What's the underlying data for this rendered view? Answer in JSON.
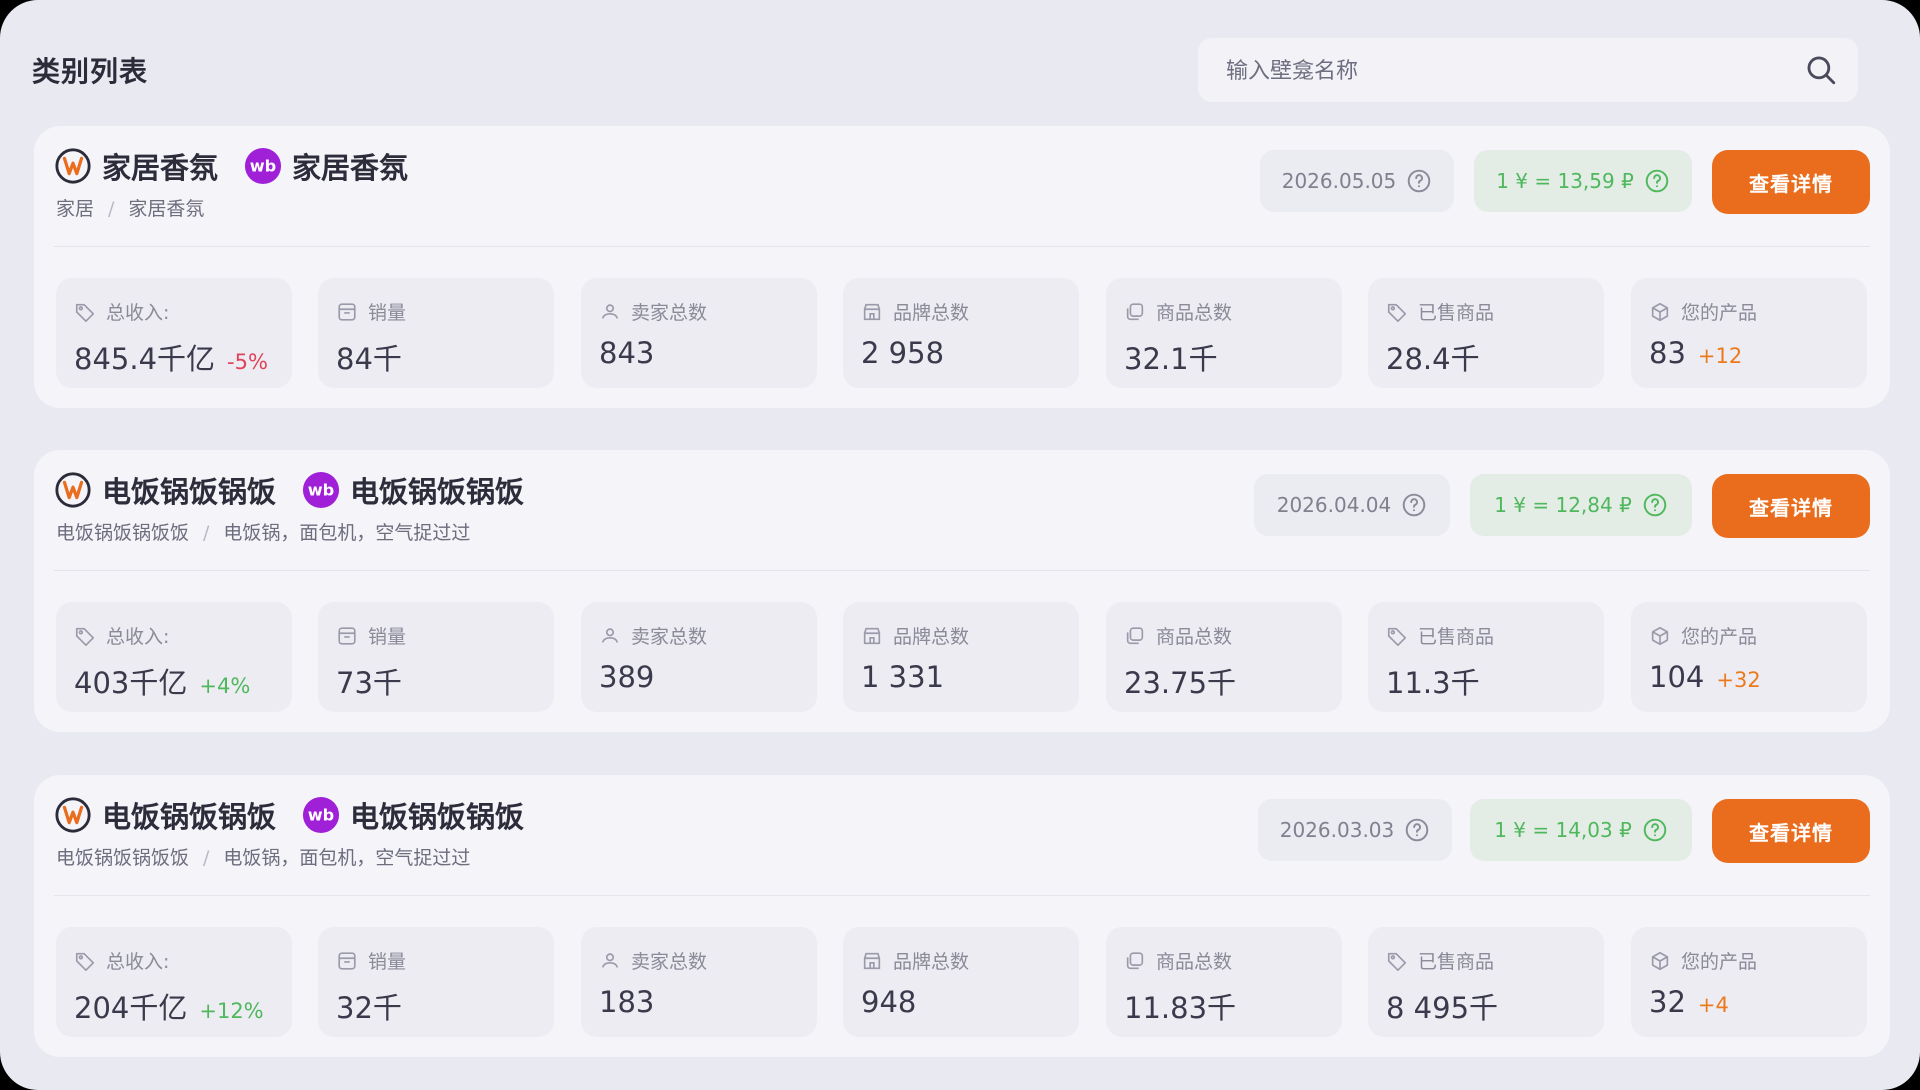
{
  "header": {
    "title": "类别列表",
    "search_placeholder": "输入壁龛名称"
  },
  "colors": {
    "accent": "#ea6d1e",
    "positive": "#4fb85d",
    "negative": "#e0435a",
    "orange_delta": "#ec7a1d",
    "wb_purple": "#a020d8"
  },
  "stat_icons": [
    "price-tag-icon",
    "sales-box-icon",
    "sellers-icon",
    "store-icon",
    "products-icon",
    "sold-tag-icon",
    "package-icon"
  ],
  "cards": [
    {
      "ozon_title": "家居香氛",
      "wb_title": "家居香氛",
      "breadcrumb": [
        "家居",
        "家居香氛"
      ],
      "date": "2026.05.05",
      "rate": "1 ¥ = 13,59 ₽",
      "detail_label": "查看详情",
      "stats": [
        {
          "label": "总收入:",
          "value": "845.4千亿",
          "delta": "-5%",
          "delta_color": "#e0435a"
        },
        {
          "label": "销量",
          "value": "84千",
          "delta": "",
          "delta_color": ""
        },
        {
          "label": "卖家总数",
          "value": "843",
          "delta": "",
          "delta_color": ""
        },
        {
          "label": "品牌总数",
          "value": "2 958",
          "delta": "",
          "delta_color": ""
        },
        {
          "label": "商品总数",
          "value": "32.1千",
          "delta": "",
          "delta_color": ""
        },
        {
          "label": "已售商品",
          "value": "28.4千",
          "delta": "",
          "delta_color": ""
        },
        {
          "label": "您的产品",
          "value": "83",
          "delta": "+12",
          "delta_color": "#ec7a1d"
        }
      ]
    },
    {
      "ozon_title": "电饭锅饭锅饭",
      "wb_title": "电饭锅饭锅饭",
      "breadcrumb": [
        "电饭锅饭锅饭饭",
        "电饭锅，面包机，空气捉过过"
      ],
      "date": "2026.04.04",
      "rate": "1 ¥ = 12,84 ₽",
      "detail_label": "查看详情",
      "stats": [
        {
          "label": "总收入:",
          "value": "403千亿",
          "delta": "+4%",
          "delta_color": "#4fb85d"
        },
        {
          "label": "销量",
          "value": "73千",
          "delta": "",
          "delta_color": ""
        },
        {
          "label": "卖家总数",
          "value": "389",
          "delta": "",
          "delta_color": ""
        },
        {
          "label": "品牌总数",
          "value": "1 331",
          "delta": "",
          "delta_color": ""
        },
        {
          "label": "商品总数",
          "value": "23.75千",
          "delta": "",
          "delta_color": ""
        },
        {
          "label": "已售商品",
          "value": "11.3千",
          "delta": "",
          "delta_color": ""
        },
        {
          "label": "您的产品",
          "value": "104",
          "delta": "+32",
          "delta_color": "#ec7a1d"
        }
      ]
    },
    {
      "ozon_title": "电饭锅饭锅饭",
      "wb_title": "电饭锅饭锅饭",
      "breadcrumb": [
        "电饭锅饭锅饭饭",
        "电饭锅，面包机，空气捉过过"
      ],
      "date": "2026.03.03",
      "rate": "1 ¥ = 14,03 ₽",
      "detail_label": "查看详情",
      "stats": [
        {
          "label": "总收入:",
          "value": "204千亿",
          "delta": "+12%",
          "delta_color": "#4fb85d"
        },
        {
          "label": "销量",
          "value": "32千",
          "delta": "",
          "delta_color": ""
        },
        {
          "label": "卖家总数",
          "value": "183",
          "delta": "",
          "delta_color": ""
        },
        {
          "label": "品牌总数",
          "value": "948",
          "delta": "",
          "delta_color": ""
        },
        {
          "label": "商品总数",
          "value": "11.83千",
          "delta": "",
          "delta_color": ""
        },
        {
          "label": "已售商品",
          "value": "8 495千",
          "delta": "",
          "delta_color": ""
        },
        {
          "label": "您的产品",
          "value": "32",
          "delta": "+4",
          "delta_color": "#ec7a1d"
        }
      ]
    }
  ]
}
